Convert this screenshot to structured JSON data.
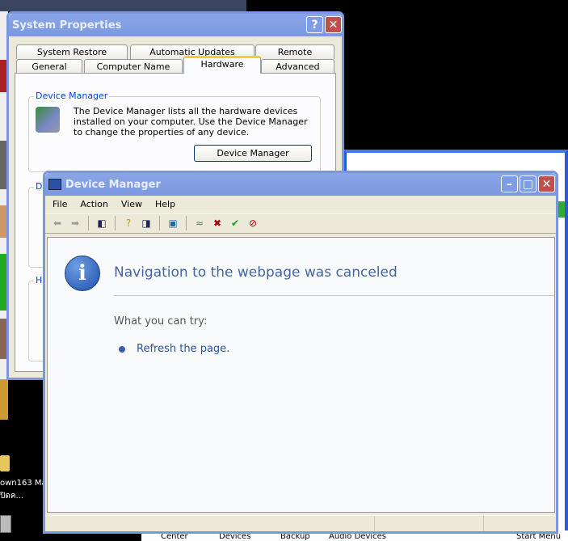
{
  "system_properties": {
    "title": "System Properties",
    "tabs_row1": [
      "System Restore",
      "Automatic Updates",
      "Remote"
    ],
    "tabs_row2": [
      "General",
      "Computer Name",
      "Hardware",
      "Advanced"
    ],
    "selected_tab": "Hardware",
    "device_manager_group": {
      "label": "Device Manager",
      "description": "The Device Manager lists all the hardware devices installed on your computer. Use the Device Manager to change the properties of any device.",
      "button": "Device Manager"
    },
    "driver_group_label": "Dr",
    "hardware_group_label": "Ha"
  },
  "device_manager": {
    "title": "Device Manager",
    "menu": [
      "File",
      "Action",
      "View",
      "Help"
    ],
    "message_title": "Navigation to the webpage was canceled",
    "try_label": "What you can try:",
    "refresh_link": "Refresh the page."
  },
  "desktop": {
    "icon1_line1": "own163 Ma",
    "icon1_line2": "ปิดค..."
  },
  "back_window": {
    "labels": [
      "Center",
      "Devices",
      "Backup",
      "Audio Devices",
      "Start Menu"
    ]
  }
}
